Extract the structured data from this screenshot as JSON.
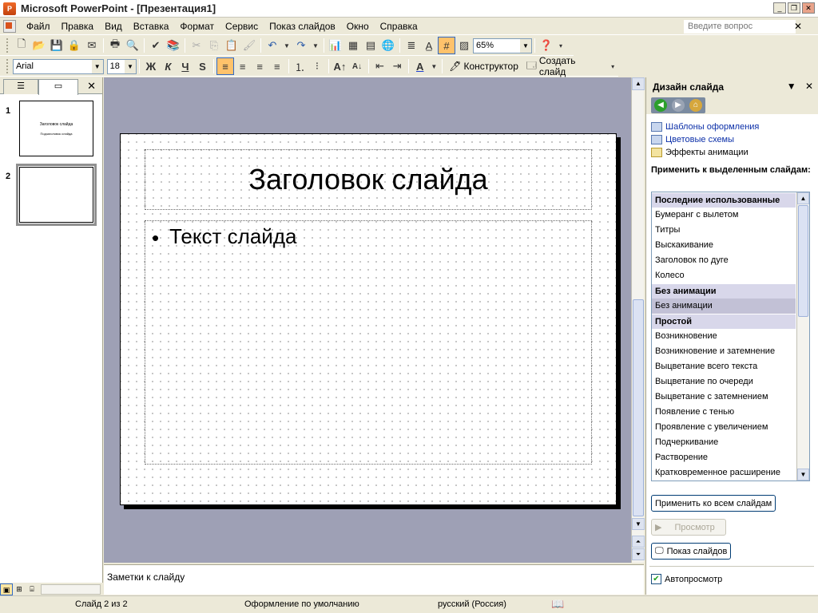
{
  "window": {
    "title": "Microsoft PowerPoint - [Презентация1]"
  },
  "menu": {
    "items": [
      "Файл",
      "Правка",
      "Вид",
      "Вставка",
      "Формат",
      "Сервис",
      "Показ слайдов",
      "Окно",
      "Справка"
    ],
    "help_placeholder": "Введите вопрос"
  },
  "toolbar": {
    "zoom": "65%",
    "font": "Arial",
    "font_size": "18",
    "bold": "Ж",
    "italic": "К",
    "underline": "Ч",
    "shadow": "S",
    "designer_label": "Конструктор",
    "new_slide_label": "Создать слайд"
  },
  "left_panel": {
    "slides": [
      {
        "number": "1",
        "title": "Заголовок слайда",
        "subtitle": "Подзаголовок слайда"
      },
      {
        "number": "2"
      }
    ]
  },
  "slide": {
    "title": "Заголовок слайда",
    "bullet": "•",
    "body": "Текст слайда"
  },
  "notes": {
    "placeholder": "Заметки к слайду"
  },
  "task_pane": {
    "title": "Дизайн слайда",
    "links": [
      "Шаблоны оформления",
      "Цветовые схемы",
      "Эффекты анимации"
    ],
    "apply_label": "Применить к выделенным слайдам:",
    "list": [
      {
        "text": "Последние использованные",
        "type": "header"
      },
      {
        "text": "Бумеранг с вылетом",
        "type": "item"
      },
      {
        "text": "Титры",
        "type": "item"
      },
      {
        "text": "Выскакивание",
        "type": "item"
      },
      {
        "text": "Заголовок по дуге",
        "type": "item"
      },
      {
        "text": "Колесо",
        "type": "item"
      },
      {
        "text": "Без анимации",
        "type": "header"
      },
      {
        "text": "Без анимации",
        "type": "selected"
      },
      {
        "text": "Простой",
        "type": "header"
      },
      {
        "text": "Возникновение",
        "type": "item"
      },
      {
        "text": "Возникновение и затемнение",
        "type": "item"
      },
      {
        "text": "Выцветание всего текста",
        "type": "item"
      },
      {
        "text": "Выцветание по очереди",
        "type": "item"
      },
      {
        "text": "Выцветание с затемнением",
        "type": "item"
      },
      {
        "text": "Появление с тенью",
        "type": "item"
      },
      {
        "text": "Проявление с увеличением",
        "type": "item"
      },
      {
        "text": "Подчеркивание",
        "type": "item"
      },
      {
        "text": "Растворение",
        "type": "item"
      },
      {
        "text": "Кратковременное расширение",
        "type": "item"
      }
    ],
    "apply_all_label": "Применить ко всем слайдам",
    "preview_label": "Просмотр",
    "slideshow_label": "Показ слайдов",
    "autopreview_label": "Автопросмотр"
  },
  "status": {
    "slide": "Слайд 2 из 2",
    "design": "Оформление по умолчанию",
    "language": "русский (Россия)"
  }
}
